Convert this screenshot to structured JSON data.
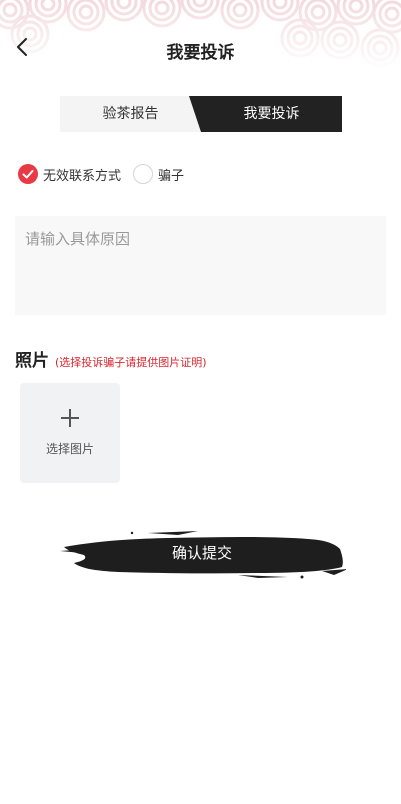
{
  "nav": {
    "title": "我要投诉"
  },
  "tabs": [
    {
      "label": "验茶报告",
      "active": false
    },
    {
      "label": "我要投诉",
      "active": true
    }
  ],
  "complaint_types": [
    {
      "label": "无效联系方式",
      "checked": true
    },
    {
      "label": "骗子",
      "checked": false
    }
  ],
  "reason": {
    "placeholder": "请输入具体原因",
    "value": ""
  },
  "photos": {
    "title": "照片",
    "hint": "(选择投诉骗子请提供图片证明)",
    "upload_label": "选择图片"
  },
  "submit": {
    "label": "确认提交"
  },
  "colors": {
    "accent": "#e83a44",
    "dark": "#222222",
    "hint": "#d8262f",
    "pattern": "#f6dfe3"
  }
}
